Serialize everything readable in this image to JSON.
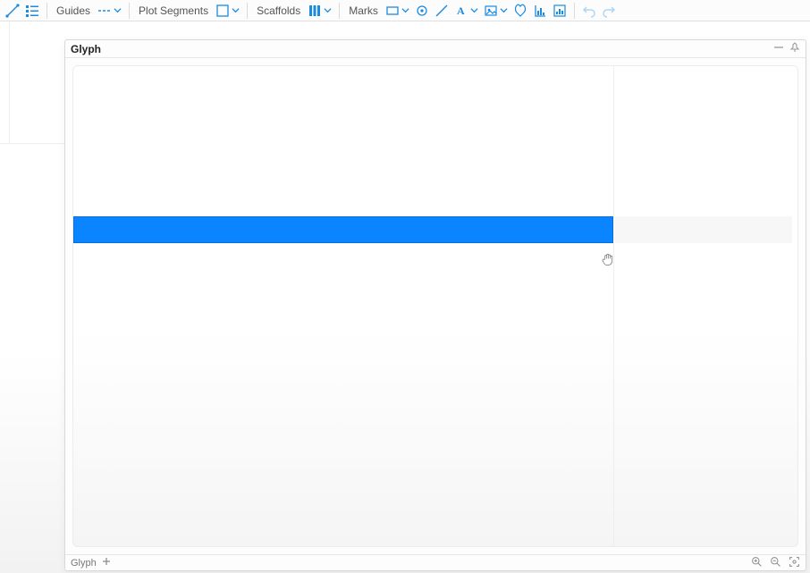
{
  "toolbar": {
    "guides_label": "Guides",
    "plot_segments_label": "Plot Segments",
    "scaffolds_label": "Scaffolds",
    "marks_label": "Marks"
  },
  "panel": {
    "title": "Glyph",
    "footer_tab": "Glyph"
  },
  "glyph": {
    "bar_color": "#0b84ff"
  }
}
